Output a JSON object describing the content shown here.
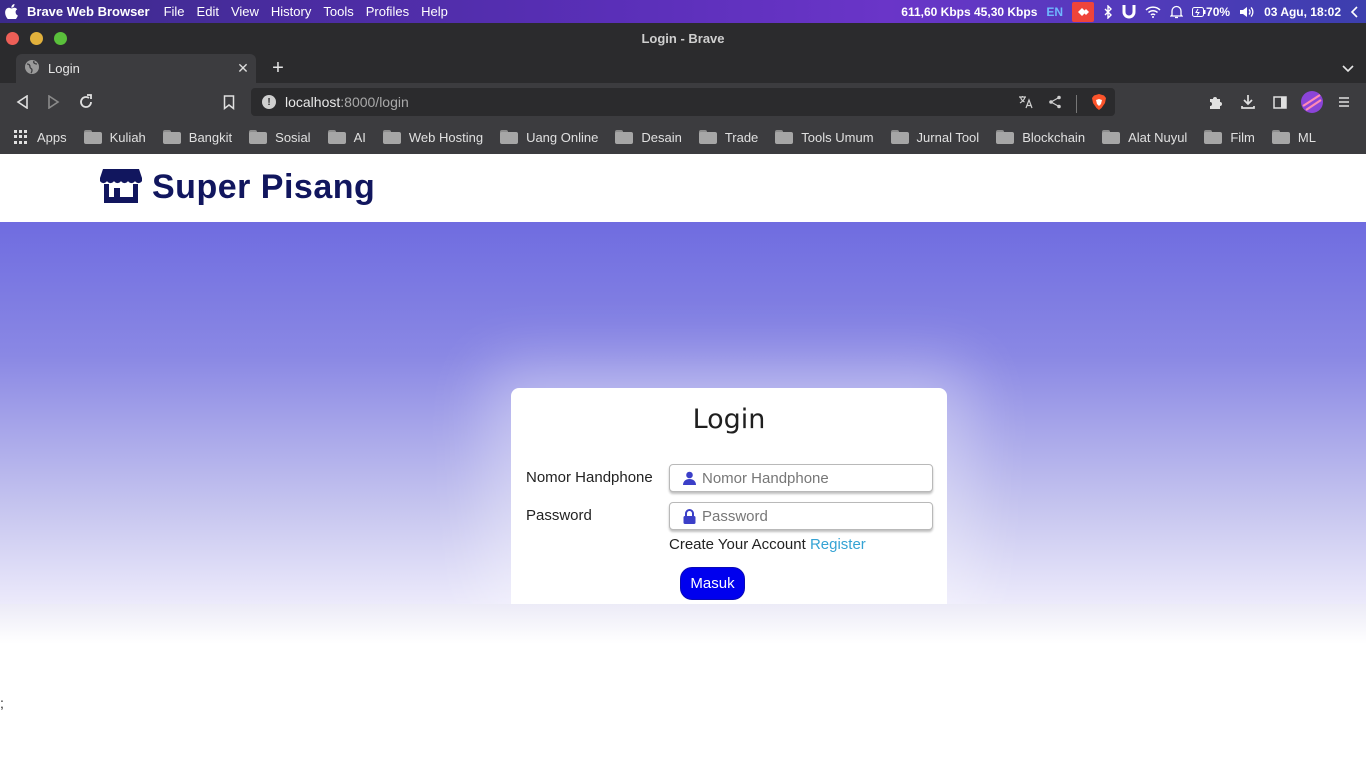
{
  "menubar": {
    "app_name": "Brave Web Browser",
    "menus": [
      "File",
      "Edit",
      "View",
      "History",
      "Tools",
      "Profiles",
      "Help"
    ],
    "network": "611,60 Kbps 45,30 Kbps",
    "lang": "EN",
    "battery": "70%",
    "datetime": "03 Agu, 18:02"
  },
  "window": {
    "title": "Login - Brave"
  },
  "tab": {
    "title": "Login"
  },
  "omnibox": {
    "host": "localhost",
    "path": ":8000/login"
  },
  "bookmarks": {
    "apps_label": "Apps",
    "folders": [
      "Kuliah",
      "Bangkit",
      "Sosial",
      "AI",
      "Web Hosting",
      "Uang Online",
      "Desain",
      "Trade",
      "Tools Umum",
      "Jurnal Tool",
      "Blockchain",
      "Alat Nuyul",
      "Film",
      "ML"
    ]
  },
  "site": {
    "brand": "Super Pisang"
  },
  "login": {
    "heading": "Login",
    "phone_label": "Nomor Handphone",
    "phone_placeholder": "Nomor Handphone",
    "password_label": "Password",
    "password_placeholder": "Password",
    "create_text": "Create Your Account",
    "register_link": "Register",
    "submit_label": "Masuk"
  },
  "stray_text": ";",
  "colors": {
    "brand": "#11165e",
    "accent": "#0000ee",
    "link": "#35a3d4",
    "hero_top": "#6f6ce0"
  }
}
